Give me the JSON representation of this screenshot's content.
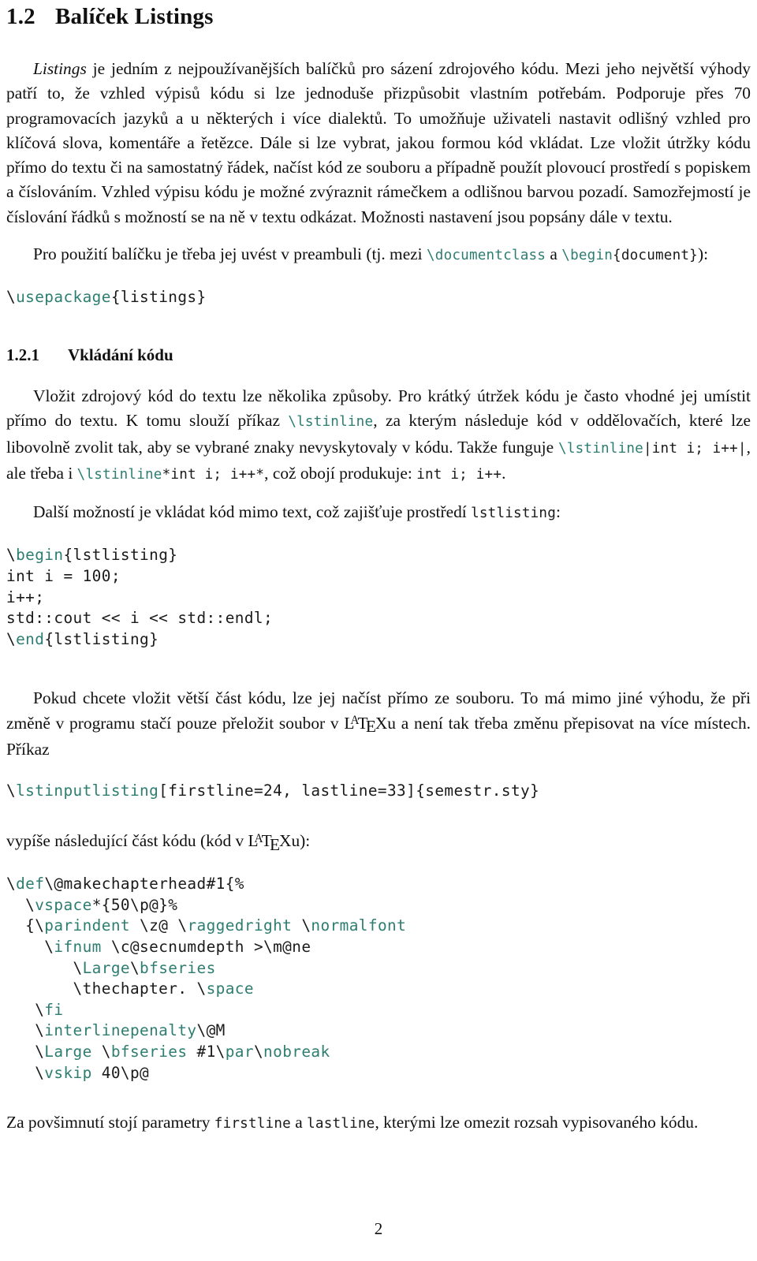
{
  "document": {
    "language": "cs",
    "page_number": "2",
    "colors": {
      "text": "#101010",
      "code_keyword": "#2d7d71",
      "code_plain": "#1a1a1a",
      "background": "#ffffff"
    }
  },
  "section": {
    "number": "1.2",
    "title": "Balíček Listings"
  },
  "paragraphs": {
    "p1_lead_italic": "Listings",
    "p1_rest": " je jedním z nejpoužívanějších balíčků pro sázení zdrojového kódu. Mezi jeho největší výhody patří to, že vzhled výpisů kódu si lze jednoduše přizpůsobit vlastním potřebám. Podporuje přes 70 programovacích jazyků a u některých i více dialektů. To umožňuje uživateli nastavit odlišný vzhled pro klíčová slova, komentáře a řetězce. Dále si lze vybrat, jakou formou kód vkládat. Lze vložit útržky kódu přímo do textu či na samostatný řádek, načíst kód ze souboru a případně použít plovoucí prostředí s popiskem a číslováním. Vzhled výpisu kódu je možné zvýraznit rámečkem a odlišnou barvou pozadí. Samozřejmostí je číslování řádků s možností se na ně v textu odkázat. Možnosti nastavení jsou popsány dále v textu.",
    "p2_a": "Pro použití balíčku je třeba jej uvést v preambuli (tj. mezi ",
    "p2_code1": "\\documentclass",
    "p2_b": " a ",
    "p2_code2": "\\begin",
    "p2_code2b": "{document}",
    "p2_c": "):"
  },
  "code_usepackage": {
    "keyword": "\\usepackage",
    "rest": "{listings}"
  },
  "subsection": {
    "number": "1.2.1",
    "title": "Vkládání kódu"
  },
  "paragraphs2": {
    "p3_a": "Vložit zdrojový kód do textu lze několika způsoby. Pro krátký útržek kódu je často vhodné jej umístit přímo do textu. K tomu slouží příkaz ",
    "p3_code1": "\\lstinline",
    "p3_b": ", za kterým následuje kód v oddělovačích, které lze libovolně zvolit tak, aby se vybrané znaky nevyskytovaly v kódu. Takže funguje ",
    "p3_code2": "\\lstinline",
    "p3_code2b": "|int i; i++|",
    "p3_c": ", ale třeba i ",
    "p3_code3": "\\lstinline",
    "p3_code3b": "*int i; i++*",
    "p3_d": ", což obojí produkuje: ",
    "p3_code4": "int i; i++",
    "p3_e": ".",
    "p4_a": "Další možností je vkládat kód mimo text, což zajišťuje prostředí ",
    "p4_code": "lstlisting",
    "p4_b": ":"
  },
  "code_lstlisting": {
    "line1_kw": "\\begin",
    "line1_rest": "{lstlisting}",
    "line2": "int i = 100;",
    "line3": "i++;",
    "line4": "std::cout << i << std::endl;",
    "line5_kw": "\\end",
    "line5_rest": "{lstlisting}"
  },
  "paragraphs3": {
    "p5_a": "Pokud chcete vložit větší část kódu, lze jej načíst přímo ze souboru. To má mimo jiné výhodu, že při změně v programu stačí pouze přeložit soubor v ",
    "p5_latex": "LaTeX",
    "p5_b": "u a není tak třeba změnu přepisovat na více místech. Příkaz"
  },
  "code_lstinputlisting": {
    "keyword": "\\lstinputlisting",
    "rest": "[firstline=24, lastline=33]{semestr.sty}"
  },
  "paragraphs4": {
    "p6_a": "vypíše následující část kódu (kód v ",
    "p6_latex": "LaTeX",
    "p6_b": "u):"
  },
  "code_listing_main": {
    "lines": [
      [
        {
          "t": "\\",
          "k": false
        },
        {
          "t": "def",
          "k": true
        },
        {
          "t": "\\",
          "k": false
        },
        {
          "t": "@makechapterhead",
          "k": false
        },
        {
          "t": "#1{%",
          "k": false
        }
      ],
      [
        {
          "t": "  \\",
          "k": false
        },
        {
          "t": "vspace",
          "k": true
        },
        {
          "t": "*{50",
          "k": false
        },
        {
          "t": "\\",
          "k": false
        },
        {
          "t": "p@",
          "k": false
        },
        {
          "t": "}%",
          "k": false
        }
      ],
      [
        {
          "t": "  {\\",
          "k": false
        },
        {
          "t": "parindent",
          "k": true
        },
        {
          "t": " \\",
          "k": false
        },
        {
          "t": "z@",
          "k": false
        },
        {
          "t": " \\",
          "k": false
        },
        {
          "t": "raggedright",
          "k": true
        },
        {
          "t": " \\",
          "k": false
        },
        {
          "t": "normalfont",
          "k": true
        }
      ],
      [
        {
          "t": "    \\",
          "k": false
        },
        {
          "t": "ifnum",
          "k": true
        },
        {
          "t": " \\",
          "k": false
        },
        {
          "t": "c@secnumdepth",
          "k": false
        },
        {
          "t": " >\\",
          "k": false
        },
        {
          "t": "m@ne",
          "k": false
        }
      ],
      [
        {
          "t": "       \\",
          "k": false
        },
        {
          "t": "Large",
          "k": true
        },
        {
          "t": "\\",
          "k": false
        },
        {
          "t": "bfseries",
          "k": true
        }
      ],
      [
        {
          "t": "       \\",
          "k": false
        },
        {
          "t": "thechapter",
          "k": false
        },
        {
          "t": ". \\",
          "k": false
        },
        {
          "t": "space",
          "k": true
        }
      ],
      [
        {
          "t": "   \\",
          "k": false
        },
        {
          "t": "fi",
          "k": true
        }
      ],
      [
        {
          "t": "   \\",
          "k": false
        },
        {
          "t": "interlinepenalty",
          "k": true
        },
        {
          "t": "\\",
          "k": false
        },
        {
          "t": "@M",
          "k": false
        }
      ],
      [
        {
          "t": "   \\",
          "k": false
        },
        {
          "t": "Large",
          "k": true
        },
        {
          "t": " \\",
          "k": false
        },
        {
          "t": "bfseries",
          "k": true
        },
        {
          "t": " #1",
          "k": false
        },
        {
          "t": "\\",
          "k": false
        },
        {
          "t": "par",
          "k": true
        },
        {
          "t": "\\",
          "k": false
        },
        {
          "t": "nobreak",
          "k": true
        }
      ],
      [
        {
          "t": "   \\",
          "k": false
        },
        {
          "t": "vskip",
          "k": true
        },
        {
          "t": " 40",
          "k": false
        },
        {
          "t": "\\",
          "k": false
        },
        {
          "t": "p@",
          "k": false
        }
      ]
    ]
  },
  "paragraphs5": {
    "p7_a": "Za povšimnutí stojí parametry ",
    "p7_code1": "firstline",
    "p7_b": " a ",
    "p7_code2": "lastline",
    "p7_c": ", kterými lze omezit rozsah vypisovaného kódu."
  }
}
